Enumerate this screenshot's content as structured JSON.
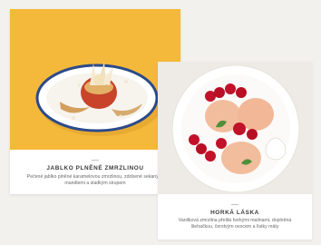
{
  "cards": [
    {
      "title": "JABLKO PLNĚNÉ ZMRZLINOU",
      "description": "Pečené jablko plněné karamelovou zmrzlinou, zdobené sekanými mandlemi a sladkým sirupem"
    },
    {
      "title": "HORKÁ LÁSKA",
      "description": "Vanilková zmrzlina přelitá horkými malinami, doplněná šlehačkou, čerstvým ovocem a lístky máty"
    }
  ],
  "colors": {
    "left_photo_bg": "#f4b93a",
    "right_photo_bg": "#eeebe6",
    "page_bg": "#f3f1ee"
  }
}
